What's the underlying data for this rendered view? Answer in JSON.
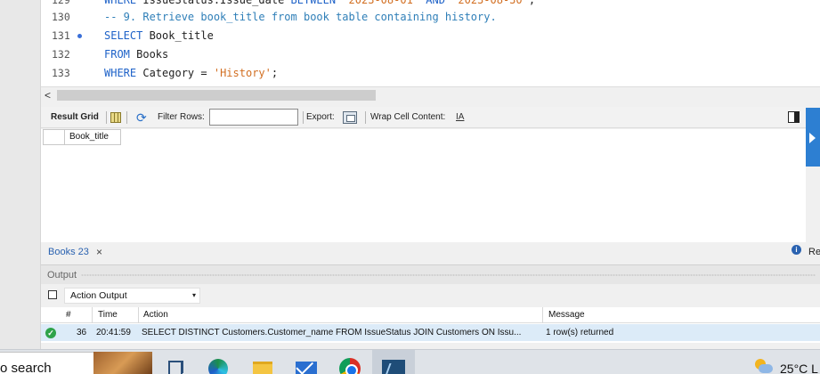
{
  "editor": {
    "lines": [
      {
        "number": "129",
        "parts": [
          {
            "text": "WHERE ",
            "cls": "kw"
          },
          {
            "text": "IssueStatus.Issue_date ",
            "cls": ""
          },
          {
            "text": "BETWEEN ",
            "cls": "kw"
          },
          {
            "text": "'2023-08-01' ",
            "cls": "str"
          },
          {
            "text": "AND ",
            "cls": "kw"
          },
          {
            "text": "'2023-08-30'",
            "cls": "str"
          },
          {
            "text": ";",
            "cls": ""
          }
        ]
      },
      {
        "number": "130",
        "parts": [
          {
            "text": "-- 9. Retrieve book_title from book table containing history.",
            "cls": "cm"
          }
        ]
      },
      {
        "number": "131",
        "executing": true,
        "parts": [
          {
            "text": "SELECT ",
            "cls": "kw"
          },
          {
            "text": "Book_title",
            "cls": ""
          }
        ]
      },
      {
        "number": "132",
        "parts": [
          {
            "text": "FROM ",
            "cls": "kw"
          },
          {
            "text": "Books",
            "cls": ""
          }
        ]
      },
      {
        "number": "133",
        "parts": [
          {
            "text": "WHERE ",
            "cls": "kw"
          },
          {
            "text": "Category = ",
            "cls": ""
          },
          {
            "text": "'History'",
            "cls": "str"
          },
          {
            "text": ";",
            "cls": ""
          }
        ]
      }
    ]
  },
  "hscroll": {
    "left_arrow": "<"
  },
  "result_toolbar": {
    "result_grid_label": "Result Grid",
    "filter_rows_label": "Filter Rows:",
    "filter_rows_value": "",
    "export_label": "Export:",
    "wrap_cell_label": "Wrap Cell Content:",
    "wrap_icon_glyph": "IA"
  },
  "grid": {
    "columns": [
      "Book_title"
    ],
    "rows": []
  },
  "result_tabs": {
    "tabs": [
      {
        "label": "Books 23",
        "close": "×"
      }
    ],
    "right_text": "Re",
    "info_glyph": "i"
  },
  "output": {
    "title": "Output",
    "selector_value": "Action Output",
    "selector_arrow": "▾",
    "headers": {
      "num": "#",
      "time": "Time",
      "action": "Action",
      "message": "Message"
    },
    "rows": [
      {
        "status": "ok",
        "status_glyph": "✓",
        "num": "36",
        "time": "20:41:59",
        "action": "SELECT DISTINCT Customers.Customer_name FROM IssueStatus JOIN Customers ON Issu...",
        "message": "1 row(s) returned"
      }
    ]
  },
  "taskbar": {
    "search_text": "o search",
    "temperature": "25°C  L",
    "apps": [
      "photo-app",
      "task-view",
      "edge",
      "file-explorer",
      "mail",
      "chrome",
      "mysql-workbench"
    ]
  },
  "colors": {
    "keyword": "#1e62c8",
    "comment": "#2f7fb8",
    "string": "#d26f22",
    "accent_blue": "#2d7fd2",
    "row_highlight": "#dcebf8",
    "success_green": "#2fa34a"
  }
}
